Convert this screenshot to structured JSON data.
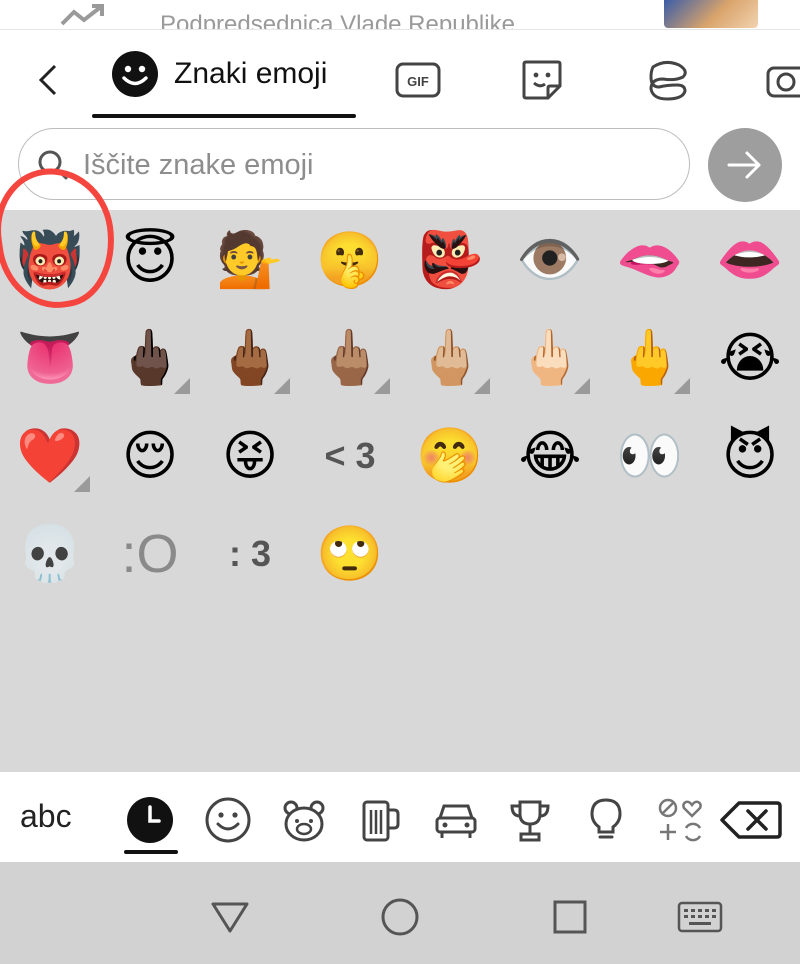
{
  "background_page": {
    "headline_fragment": "Podpredsednica Vlade Republike"
  },
  "tabs": {
    "active_label": "Znaki emoji",
    "gif_label": "GIF",
    "items": [
      "back-icon",
      "emoji-tab-icon",
      "gif-icon",
      "sticker-icon",
      "bitmoji-icon",
      "camera-icon"
    ]
  },
  "search": {
    "placeholder": "Iščite znake emoji",
    "value": ""
  },
  "emoji_grid": {
    "rows": [
      [
        "👹",
        "😇",
        "💁",
        "🤫",
        "👺",
        "👁️",
        "🫦",
        "👄"
      ],
      [
        "👅",
        "🖕🏿",
        "🖕🏾",
        "🖕🏽",
        "🖕🏼",
        "🖕🏻",
        "🖕",
        "😭"
      ],
      [
        "❤️",
        "😌",
        "😝",
        "< 3",
        "🤭",
        "😂",
        "👀",
        "😈"
      ],
      [
        "💀",
        ":O",
        ": 3",
        "🙄"
      ]
    ],
    "skin_tone_variants": [
      [
        2,
        0
      ],
      [
        1,
        1
      ],
      [
        1,
        2
      ],
      [
        1,
        3
      ],
      [
        1,
        4
      ],
      [
        1,
        5
      ],
      [
        1,
        6
      ]
    ],
    "highlighted": "👹"
  },
  "category_bar": {
    "abc_label": "abc",
    "items": [
      "recent-icon",
      "smileys-icon",
      "animals-icon",
      "food-icon",
      "travel-icon",
      "activities-icon",
      "objects-icon",
      "symbols-icon",
      "backspace-icon"
    ],
    "active": "recent-icon"
  },
  "nav_bar": {
    "items": [
      "back-triangle-icon",
      "home-circle-icon",
      "recents-square-icon",
      "keyboard-icon"
    ]
  },
  "colors": {
    "grid_background": "#d8d8d8",
    "nav_background": "#d2d2d2",
    "highlight_ring": "#f4463f",
    "go_button": "#9e9e9e"
  }
}
